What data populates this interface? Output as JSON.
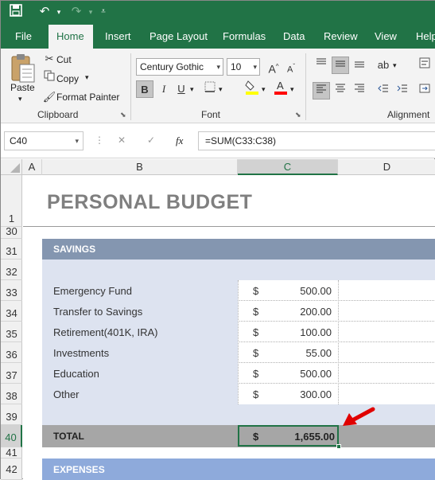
{
  "quick_access": [
    "save-icon",
    "undo-icon",
    "redo-icon",
    "customize-icon"
  ],
  "tabs": [
    "File",
    "Home",
    "Insert",
    "Page Layout",
    "Formulas",
    "Data",
    "Review",
    "View",
    "Help"
  ],
  "active_tab": "Home",
  "clipboard": {
    "paste": "Paste",
    "cut": "Cut",
    "copy": "Copy",
    "format_painter": "Format Painter",
    "label": "Clipboard"
  },
  "font": {
    "name": "Century Gothic",
    "size": "10",
    "bold": "B",
    "italic": "I",
    "underline": "U",
    "grow": "A",
    "shrink": "A",
    "label": "Font",
    "fill_color": "#ffff00",
    "font_color": "#ff0000"
  },
  "alignment": {
    "label": "Alignment"
  },
  "formula_bar": {
    "name_box": "C40",
    "cancel": "✕",
    "enter": "✓",
    "fx": "fx",
    "formula": "=SUM(C33:C38)"
  },
  "columns": [
    "A",
    "B",
    "C",
    "D"
  ],
  "selected_column": "C",
  "rows": [
    "1",
    "30",
    "31",
    "32",
    "33",
    "34",
    "35",
    "36",
    "37",
    "38",
    "39",
    "40",
    "41",
    "42"
  ],
  "selected_row": "40",
  "sheet": {
    "title": "PERSONAL BUDGET",
    "savings_header": "SAVINGS",
    "items": [
      {
        "label": "Emergency Fund",
        "currency": "$",
        "amount": "500.00"
      },
      {
        "label": "Transfer to Savings",
        "currency": "$",
        "amount": "200.00"
      },
      {
        "label": "Retirement(401K, IRA)",
        "currency": "$",
        "amount": "100.00"
      },
      {
        "label": "Investments",
        "currency": "$",
        "amount": "55.00"
      },
      {
        "label": "Education",
        "currency": "$",
        "amount": "500.00"
      },
      {
        "label": "Other",
        "currency": "$",
        "amount": "300.00"
      }
    ],
    "total_label": "TOTAL",
    "total_currency": "$",
    "total_amount": "1,655.00",
    "expenses_header": "EXPENSES"
  },
  "colors": {
    "excel_green": "#217346",
    "section_header": "#8496b0",
    "section_body": "#dde3f0",
    "total_band": "#a6a6a6",
    "arrow": "#e00000"
  }
}
